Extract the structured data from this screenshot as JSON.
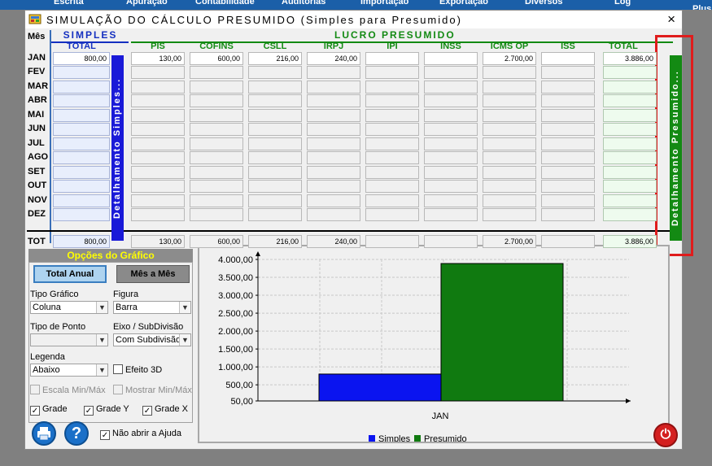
{
  "topbar": {
    "items": [
      "Escrita",
      "Apuração",
      "Contabilidade",
      "Auditorias",
      "Importação",
      "Exportação",
      "Diversos",
      "Log",
      "Plus"
    ]
  },
  "window": {
    "title": "SIMULAÇÃO DO CÁLCULO PRESUMIDO (Simples para Presumido)",
    "close_label": "×"
  },
  "headers": {
    "mes": "Mês",
    "simples": "SIMPLES",
    "lucro_presumido": "LUCRO PRESUMIDO",
    "columns": [
      "TOTAL",
      "PIS",
      "COFINS",
      "CSLL",
      "IRPJ",
      "IPI",
      "INSS",
      "ICMS OP",
      "ISS",
      "TOTAL"
    ]
  },
  "months": [
    "JAN",
    "FEV",
    "MAR",
    "ABR",
    "MAI",
    "JUN",
    "JUL",
    "AGO",
    "SET",
    "OUT",
    "NOV",
    "DEZ"
  ],
  "rows": [
    [
      "800,00",
      "130,00",
      "600,00",
      "216,00",
      "240,00",
      "",
      "",
      "2.700,00",
      "",
      "3.886,00"
    ],
    [
      "",
      "",
      "",
      "",
      "",
      "",
      "",
      "",
      "",
      ""
    ],
    [
      "",
      "",
      "",
      "",
      "",
      "",
      "",
      "",
      "",
      ""
    ],
    [
      "",
      "",
      "",
      "",
      "",
      "",
      "",
      "",
      "",
      ""
    ],
    [
      "",
      "",
      "",
      "",
      "",
      "",
      "",
      "",
      "",
      ""
    ],
    [
      "",
      "",
      "",
      "",
      "",
      "",
      "",
      "",
      "",
      ""
    ],
    [
      "",
      "",
      "",
      "",
      "",
      "",
      "",
      "",
      "",
      ""
    ],
    [
      "",
      "",
      "",
      "",
      "",
      "",
      "",
      "",
      "",
      ""
    ],
    [
      "",
      "",
      "",
      "",
      "",
      "",
      "",
      "",
      "",
      ""
    ],
    [
      "",
      "",
      "",
      "",
      "",
      "",
      "",
      "",
      "",
      ""
    ],
    [
      "",
      "",
      "",
      "",
      "",
      "",
      "",
      "",
      "",
      ""
    ],
    [
      "",
      "",
      "",
      "",
      "",
      "",
      "",
      "",
      "",
      ""
    ]
  ],
  "totals": {
    "label": "TOT",
    "values": [
      "800,00",
      "130,00",
      "600,00",
      "216,00",
      "240,00",
      "",
      "",
      "2.700,00",
      "",
      "3.886,00"
    ]
  },
  "detalhamento": {
    "simples": "Detalhamento Simples...",
    "presumido": "Detalhamento Presumido..."
  },
  "options": {
    "title": "Opções do Gráfico",
    "btn_total_anual": "Total Anual",
    "btn_mes_a_mes": "Mês a Mês",
    "tipo_grafico_label": "Tipo Gráfico",
    "tipo_grafico_value": "Coluna",
    "figura_label": "Figura",
    "figura_value": "Barra",
    "tipo_ponto_label": "Tipo de Ponto",
    "tipo_ponto_value": "",
    "eixo_label": "Eixo / SubDivisão",
    "eixo_value": "Com Subdivisão",
    "legenda_label": "Legenda",
    "legenda_value": "Abaixo",
    "efeito_3d": "Efeito 3D",
    "escala_min_max": "Escala Min/Máx",
    "mostrar_min_max": "Mostrar Min/Máx",
    "grade": "Grade",
    "grade_y": "Grade Y",
    "grade_x": "Grade X",
    "checked": {
      "efeito_3d": false,
      "escala": false,
      "mostrar": false,
      "grade": true,
      "grade_y": true,
      "grade_x": true
    }
  },
  "footer": {
    "nao_abrir_ajuda": "Não abrir a Ajuda",
    "help_glyph": "?",
    "power_glyph": "⏻",
    "nao_abrir_checked": true
  },
  "colors": {
    "simples": "#0a14f0",
    "presumido": "#107a10"
  },
  "chart_data": {
    "type": "bar",
    "categories": [
      "JAN"
    ],
    "series": [
      {
        "name": "Simples",
        "values": [
          800
        ]
      },
      {
        "name": "Presumido",
        "values": [
          3886
        ]
      }
    ],
    "yticks": [
      "4.000,00",
      "3.500,00",
      "3.000,00",
      "2.500,00",
      "2.000,00",
      "1.500,00",
      "1.000,00",
      "500,00",
      "50,00"
    ],
    "ylim": [
      50,
      4000
    ],
    "grid": true,
    "legend": "bottom"
  }
}
